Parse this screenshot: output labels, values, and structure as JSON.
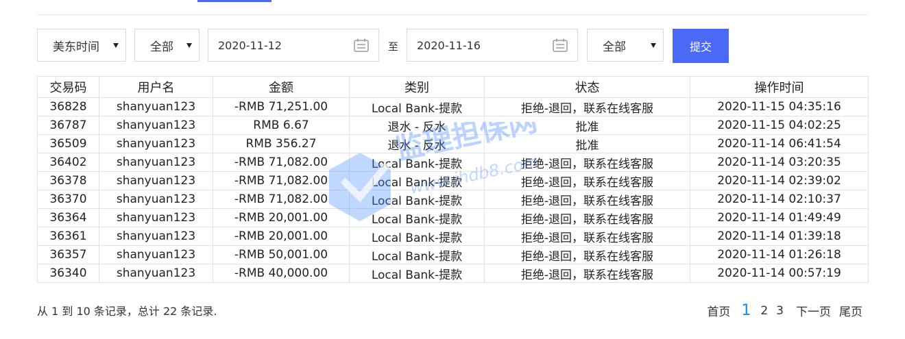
{
  "filters": {
    "timezone": "美东时间",
    "type": "全部",
    "start_date": "2020-11-12",
    "range_separator": "至",
    "end_date": "2020-11-16",
    "status": "全部",
    "submit_label": "提交"
  },
  "table": {
    "headers": [
      "交易码",
      "用户名",
      "金额",
      "类别",
      "状态",
      "操作时间"
    ],
    "rows": [
      [
        "36828",
        "shanyuan123",
        "-RMB 71,251.00",
        "Local Bank-提款",
        "拒绝-退回，联系在线客服",
        "2020-11-15 04:35:16"
      ],
      [
        "36787",
        "shanyuan123",
        "RMB 6.67",
        "退水 - 反水",
        "批准",
        "2020-11-15 04:02:25"
      ],
      [
        "36509",
        "shanyuan123",
        "RMB 356.27",
        "退水 - 反水",
        "批准",
        "2020-11-14 06:41:54"
      ],
      [
        "36402",
        "shanyuan123",
        "-RMB 71,082.00",
        "Local Bank-提款",
        "拒绝-退回，联系在线客服",
        "2020-11-14 03:20:35"
      ],
      [
        "36378",
        "shanyuan123",
        "-RMB 71,082.00",
        "Local Bank-提款",
        "拒绝-退回，联系在线客服",
        "2020-11-14 02:39:02"
      ],
      [
        "36370",
        "shanyuan123",
        "-RMB 71,082.00",
        "Local Bank-提款",
        "拒绝-退回，联系在线客服",
        "2020-11-14 02:10:37"
      ],
      [
        "36364",
        "shanyuan123",
        "-RMB 20,001.00",
        "Local Bank-提款",
        "拒绝-退回，联系在线客服",
        "2020-11-14 01:49:49"
      ],
      [
        "36361",
        "shanyuan123",
        "-RMB 20,001.00",
        "Local Bank-提款",
        "拒绝-退回，联系在线客服",
        "2020-11-14 01:39:18"
      ],
      [
        "36357",
        "shanyuan123",
        "-RMB 50,001.00",
        "Local Bank-提款",
        "拒绝-退回，联系在线客服",
        "2020-11-14 01:26:18"
      ],
      [
        "36340",
        "shanyuan123",
        "-RMB 40,000.00",
        "Local Bank-提款",
        "拒绝-退回，联系在线客服",
        "2020-11-14 00:57:19"
      ]
    ]
  },
  "summary": "从 1 到 10 条记录，总计 22 条记录.",
  "pagination": {
    "first": "首页",
    "pages": [
      "1",
      "2",
      "3"
    ],
    "current": "1",
    "next": "下一页",
    "last": "尾页"
  },
  "watermark": {
    "text": "监理担保网",
    "url": "www.jhdb8.com"
  },
  "colors": {
    "accent": "#4a69f5",
    "current_page": "#1e88e5"
  }
}
